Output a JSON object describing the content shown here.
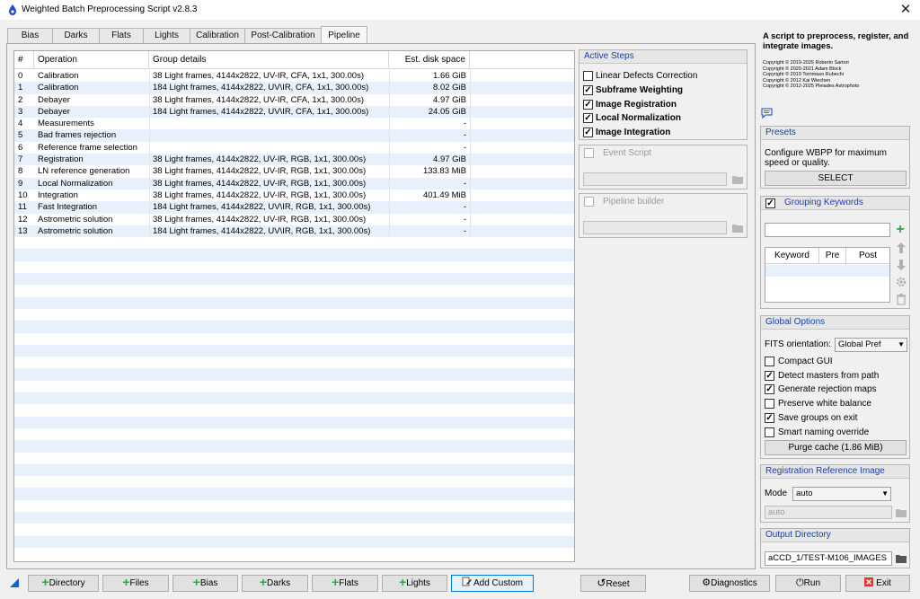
{
  "window": {
    "title": "Weighted Batch Preprocessing Script v2.8.3",
    "close_glyph": "✕"
  },
  "tabs": [
    {
      "label": "Bias",
      "active": false
    },
    {
      "label": "Darks",
      "active": false
    },
    {
      "label": "Flats",
      "active": false
    },
    {
      "label": "Lights",
      "active": false
    },
    {
      "label": "Calibration",
      "active": false
    },
    {
      "label": "Post-Calibration",
      "active": false
    },
    {
      "label": "Pipeline",
      "active": true
    }
  ],
  "table": {
    "headers": [
      "#",
      "Operation",
      "Group details",
      "Est. disk space"
    ],
    "rows": [
      [
        "0",
        "Calibration",
        "38 Light frames, 4144x2822, UV-IR, CFA, 1x1, 300.00s)",
        "1.66 GiB"
      ],
      [
        "1",
        "Calibration",
        "184 Light frames, 4144x2822, UV\\IR, CFA, 1x1, 300.00s)",
        "8.02 GiB"
      ],
      [
        "2",
        "Debayer",
        "38 Light frames, 4144x2822, UV-IR, CFA, 1x1, 300.00s)",
        "4.97 GiB"
      ],
      [
        "3",
        "Debayer",
        "184 Light frames, 4144x2822, UV\\IR, CFA, 1x1, 300.00s)",
        "24.05 GiB"
      ],
      [
        "4",
        "Measurements",
        "",
        "-"
      ],
      [
        "5",
        "Bad frames rejection",
        "",
        "-"
      ],
      [
        "6",
        "Reference frame selection",
        "",
        "-"
      ],
      [
        "7",
        "Registration",
        "38 Light frames, 4144x2822, UV-IR, RGB, 1x1, 300.00s)",
        "4.97 GiB"
      ],
      [
        "8",
        "LN reference generation",
        "38 Light frames, 4144x2822, UV-IR, RGB, 1x1, 300.00s)",
        "133.83 MiB"
      ],
      [
        "9",
        "Local Normalization",
        "38 Light frames, 4144x2822, UV-IR, RGB, 1x1, 300.00s)",
        "-"
      ],
      [
        "10",
        "Integration",
        "38 Light frames, 4144x2822, UV-IR, RGB, 1x1, 300.00s)",
        "401.49 MiB"
      ],
      [
        "11",
        "Fast Integration",
        "184 Light frames, 4144x2822, UV\\IR, RGB, 1x1, 300.00s)",
        "-"
      ],
      [
        "12",
        "Astrometric solution",
        "38 Light frames, 4144x2822, UV-IR, RGB, 1x1, 300.00s)",
        "-"
      ],
      [
        "13",
        "Astrometric solution",
        "184 Light frames, 4144x2822, UV\\IR, RGB, 1x1, 300.00s)",
        "-"
      ]
    ]
  },
  "active_steps": {
    "title": "Active Steps",
    "items": [
      {
        "label": "Linear Defects Correction",
        "checked": false,
        "bold": false
      },
      {
        "label": "Subframe Weighting",
        "checked": true,
        "bold": true
      },
      {
        "label": "Image Registration",
        "checked": true,
        "bold": true
      },
      {
        "label": "Local Normalization",
        "checked": true,
        "bold": true
      },
      {
        "label": "Image Integration",
        "checked": true,
        "bold": true
      }
    ]
  },
  "event_script": {
    "title": "Event Script",
    "checked": false,
    "path": ""
  },
  "pipeline_builder": {
    "title": "Pipeline builder",
    "checked": false,
    "path": ""
  },
  "about": {
    "description": "A script to preprocess, register, and integrate images.",
    "copyrights": [
      "Copyright © 2019-2025 Roberto Sartori",
      "Copyright © 2020-2021 Adam Block",
      "Copyright © 2019 Tommaso Rubechi",
      "Copyright © 2012 Kai Wiechen",
      "Copyright © 2012-2025 Pleiades Astrophoto"
    ]
  },
  "presets": {
    "title": "Presets",
    "text": "Configure WBPP for maximum speed or quality.",
    "button": "SELECT"
  },
  "grouping": {
    "title": "Grouping Keywords",
    "checked": true,
    "input_value": "",
    "columns": [
      "Keyword",
      "Pre",
      "Post"
    ]
  },
  "global_options": {
    "title": "Global Options",
    "fits_label": "FITS orientation:",
    "fits_value": "Global Pref",
    "options": [
      {
        "label": "Compact GUI",
        "checked": false
      },
      {
        "label": "Detect masters from path",
        "checked": true
      },
      {
        "label": "Generate rejection maps",
        "checked": true
      },
      {
        "label": "Preserve white balance",
        "checked": false
      },
      {
        "label": "Save groups on exit",
        "checked": true
      },
      {
        "label": "Smart naming override",
        "checked": false
      }
    ],
    "purge_button": "Purge cache (1.86 MiB)"
  },
  "registration_ref": {
    "title": "Registration Reference Image",
    "mode_label": "Mode",
    "mode_value": "auto",
    "path_value": "auto"
  },
  "output_dir": {
    "title": "Output Directory",
    "value": "aCCD_1/TEST-M106_IMAGES"
  },
  "bottom_buttons": {
    "directory": "Directory",
    "files": "Files",
    "bias": "Bias",
    "darks": "Darks",
    "flats": "Flats",
    "lights": "Lights",
    "add_custom": "Add Custom",
    "reset": "Reset",
    "diagnostics": "Diagnostics",
    "run": "Run",
    "exit": "Exit"
  },
  "colors": {
    "accent": "#1a3fa6",
    "add_green": "#2aa84a",
    "exit_red": "#d93a2b",
    "row_alt": "#e8f0fb"
  }
}
